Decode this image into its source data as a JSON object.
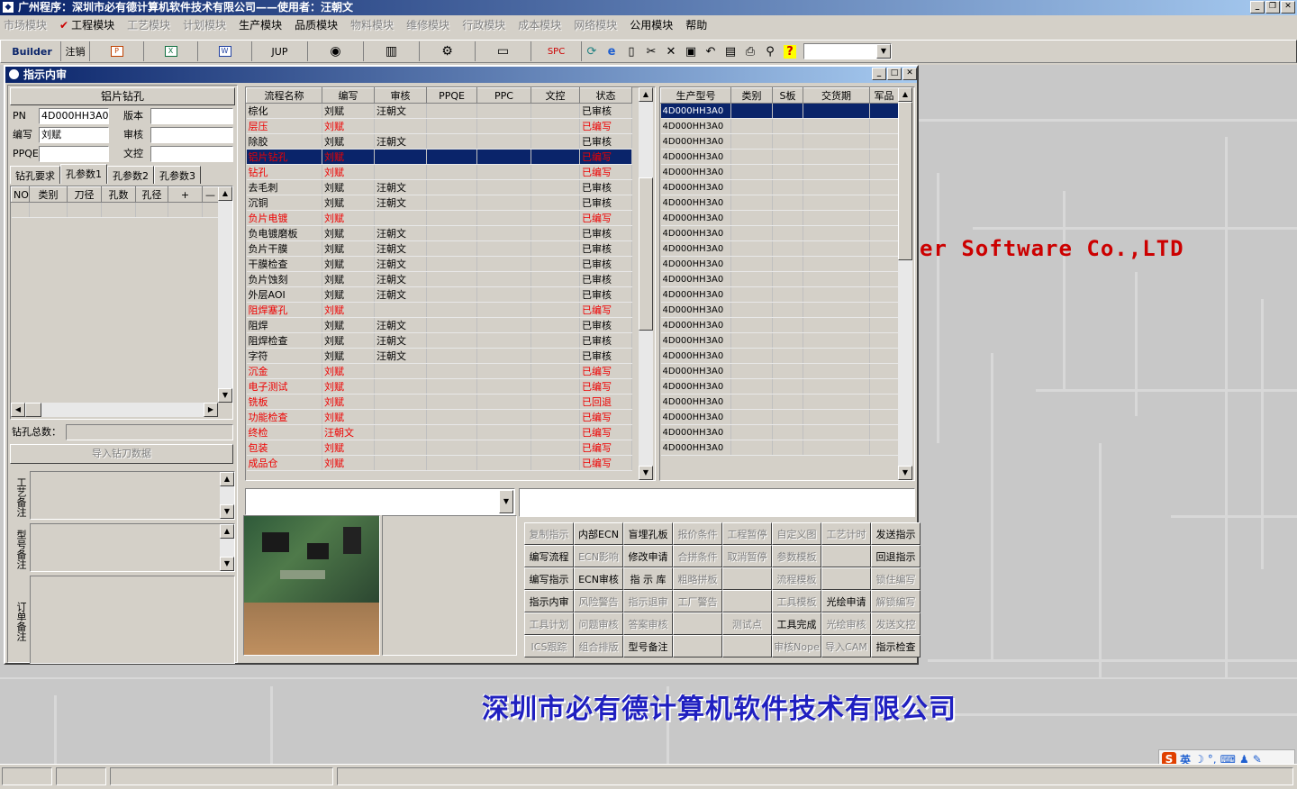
{
  "app": {
    "title": "广州程序：深圳市必有德计算机软件技术有限公司——使用者：汪朝文",
    "icon": "app-icon"
  },
  "menu": [
    {
      "label": "市场模块",
      "enabled": false
    },
    {
      "label": "工程模块",
      "enabled": true,
      "checked": true
    },
    {
      "label": "工艺模块",
      "enabled": false
    },
    {
      "label": "计划模块",
      "enabled": false
    },
    {
      "label": "生产模块",
      "enabled": true
    },
    {
      "label": "品质模块",
      "enabled": true
    },
    {
      "label": "物料模块",
      "enabled": false
    },
    {
      "label": "维修模块",
      "enabled": false
    },
    {
      "label": "行政模块",
      "enabled": false
    },
    {
      "label": "成本模块",
      "enabled": false
    },
    {
      "label": "网络模块",
      "enabled": false
    },
    {
      "label": "公用模块",
      "enabled": true
    },
    {
      "label": "帮助",
      "enabled": true
    }
  ],
  "toolbar": {
    "builder": "Builder",
    "logout": "注销",
    "jup": "JUP",
    "spc": "SPC",
    "icons": [
      "powerpoint-icon",
      "excel-icon",
      "word-icon",
      "jup-icon",
      "eye-icon",
      "database-icon",
      "network-icon",
      "computer-icon",
      "spc-icon",
      "refresh-icon",
      "ie-icon",
      "new-doc-icon",
      "cut-icon",
      "delete-icon",
      "save-icon",
      "undo-icon",
      "preview-icon",
      "print-icon",
      "find-icon",
      "help-icon"
    ]
  },
  "child": {
    "title": "指示内审"
  },
  "left": {
    "header": "铝片钻孔",
    "pn_label": "PN",
    "pn_value": "4D000HH3A0",
    "version_label": "版本",
    "version_value": "",
    "author_label": "编写",
    "author_value": "刘赋",
    "review_label": "审核",
    "review_value": "",
    "ppqe_label": "PPQE",
    "ppqe_value": "",
    "doc_label": "文控",
    "doc_value": "",
    "tabs": [
      "钻孔要求",
      "孔参数1",
      "孔参数2",
      "孔参数3"
    ],
    "active_tab": 1,
    "param_cols": [
      "NO",
      "类别",
      "刀径",
      "孔数",
      "孔径",
      "+",
      "—"
    ],
    "total_label": "钻孔总数：",
    "total_value": "",
    "import_button": "导入钻刀数据",
    "notes": [
      {
        "label": "工艺备注",
        "value": ""
      },
      {
        "label": "型号备注",
        "value": ""
      },
      {
        "label": "订单备注",
        "value": ""
      }
    ]
  },
  "flow": {
    "columns": [
      "流程名称",
      "编写",
      "审核",
      "PPQE",
      "PPC",
      "文控",
      "状态"
    ],
    "rows": [
      {
        "name": "棕化",
        "author": "刘赋",
        "reviewer": "汪朝文",
        "status": "已审核",
        "red": false
      },
      {
        "name": "层压",
        "author": "刘赋",
        "reviewer": "",
        "status": "已编写",
        "red": true
      },
      {
        "name": "除胶",
        "author": "刘赋",
        "reviewer": "汪朝文",
        "status": "已审核",
        "red": false
      },
      {
        "name": "铝片钻孔",
        "author": "刘赋",
        "reviewer": "",
        "status": "已编写",
        "red": true,
        "selected": true
      },
      {
        "name": "钻孔",
        "author": "刘赋",
        "reviewer": "",
        "status": "已编写",
        "red": true
      },
      {
        "name": "去毛刺",
        "author": "刘赋",
        "reviewer": "汪朝文",
        "status": "已审核",
        "red": false
      },
      {
        "name": "沉铜",
        "author": "刘赋",
        "reviewer": "汪朝文",
        "status": "已审核",
        "red": false
      },
      {
        "name": "负片电镀",
        "author": "刘赋",
        "reviewer": "",
        "status": "已编写",
        "red": true
      },
      {
        "name": "负电镀磨板",
        "author": "刘赋",
        "reviewer": "汪朝文",
        "status": "已审核",
        "red": false
      },
      {
        "name": "负片干膜",
        "author": "刘赋",
        "reviewer": "汪朝文",
        "status": "已审核",
        "red": false
      },
      {
        "name": "干膜检查",
        "author": "刘赋",
        "reviewer": "汪朝文",
        "status": "已审核",
        "red": false
      },
      {
        "name": "负片蚀刻",
        "author": "刘赋",
        "reviewer": "汪朝文",
        "status": "已审核",
        "red": false
      },
      {
        "name": "外层AOI",
        "author": "刘赋",
        "reviewer": "汪朝文",
        "status": "已审核",
        "red": false
      },
      {
        "name": "阻焊塞孔",
        "author": "刘赋",
        "reviewer": "",
        "status": "已编写",
        "red": true
      },
      {
        "name": "阻焊",
        "author": "刘赋",
        "reviewer": "汪朝文",
        "status": "已审核",
        "red": false
      },
      {
        "name": "阻焊检查",
        "author": "刘赋",
        "reviewer": "汪朝文",
        "status": "已审核",
        "red": false
      },
      {
        "name": "字符",
        "author": "刘赋",
        "reviewer": "汪朝文",
        "status": "已审核",
        "red": false
      },
      {
        "name": "沉金",
        "author": "刘赋",
        "reviewer": "",
        "status": "已编写",
        "red": true
      },
      {
        "name": "电子测试",
        "author": "刘赋",
        "reviewer": "",
        "status": "已编写",
        "red": true
      },
      {
        "name": "铣板",
        "author": "刘赋",
        "reviewer": "",
        "status": "已回退",
        "red": true
      },
      {
        "name": "功能检查",
        "author": "刘赋",
        "reviewer": "",
        "status": "已编写",
        "red": true
      },
      {
        "name": "终检",
        "author": "汪朝文",
        "reviewer": "",
        "status": "已编写",
        "red": true
      },
      {
        "name": "包装",
        "author": "刘赋",
        "reviewer": "",
        "status": "已编写",
        "red": true
      },
      {
        "name": "成品仓",
        "author": "刘赋",
        "reviewer": "",
        "status": "已编写",
        "red": true
      }
    ]
  },
  "models": {
    "columns": [
      "生产型号",
      "类别",
      "S板",
      "交货期",
      "军品"
    ],
    "rows": [
      "4D000HH3A0",
      "4D000HH3A0",
      "4D000HH3A0",
      "4D000HH3A0",
      "4D000HH3A0",
      "4D000HH3A0",
      "4D000HH3A0",
      "4D000HH3A0",
      "4D000HH3A0",
      "4D000HH3A0",
      "4D000HH3A0",
      "4D000HH3A0",
      "4D000HH3A0",
      "4D000HH3A0",
      "4D000HH3A0",
      "4D000HH3A0",
      "4D000HH3A0",
      "4D000HH3A0",
      "4D000HH3A0",
      "4D000HH3A0",
      "4D000HH3A0",
      "4D000HH3A0",
      "4D000HH3A0"
    ]
  },
  "combo_value": "",
  "memo_value": "",
  "actions": [
    {
      "label": "复制指示",
      "enabled": false
    },
    {
      "label": "内部ECN",
      "enabled": true
    },
    {
      "label": "盲埋孔板",
      "enabled": true
    },
    {
      "label": "报价条件",
      "enabled": false
    },
    {
      "label": "工程暂停",
      "enabled": false
    },
    {
      "label": "自定义图",
      "enabled": false
    },
    {
      "label": "工艺计时",
      "enabled": false
    },
    {
      "label": "发送指示",
      "enabled": true
    },
    {
      "label": "编写流程",
      "enabled": true
    },
    {
      "label": "ECN影响",
      "enabled": false
    },
    {
      "label": "修改申请",
      "enabled": true
    },
    {
      "label": "合拼条件",
      "enabled": false
    },
    {
      "label": "取消暂停",
      "enabled": false
    },
    {
      "label": "参数模板",
      "enabled": false
    },
    {
      "label": "",
      "enabled": false
    },
    {
      "label": "回退指示",
      "enabled": true
    },
    {
      "label": "编写指示",
      "enabled": true
    },
    {
      "label": "ECN审核",
      "enabled": true
    },
    {
      "label": "指 示 库",
      "enabled": true
    },
    {
      "label": "粗略拼板",
      "enabled": false
    },
    {
      "label": "",
      "enabled": false
    },
    {
      "label": "流程模板",
      "enabled": false
    },
    {
      "label": "",
      "enabled": false
    },
    {
      "label": "锁住编写",
      "enabled": false
    },
    {
      "label": "指示内审",
      "enabled": true
    },
    {
      "label": "风险警告",
      "enabled": false
    },
    {
      "label": "指示退审",
      "enabled": false
    },
    {
      "label": "工厂警告",
      "enabled": false
    },
    {
      "label": "",
      "enabled": false
    },
    {
      "label": "工具模板",
      "enabled": false
    },
    {
      "label": "光绘申请",
      "enabled": true
    },
    {
      "label": "解锁编写",
      "enabled": false
    },
    {
      "label": "工具计划",
      "enabled": false
    },
    {
      "label": "问题审核",
      "enabled": false
    },
    {
      "label": "答案审核",
      "enabled": false
    },
    {
      "label": "",
      "enabled": false
    },
    {
      "label": "测试点",
      "enabled": false
    },
    {
      "label": "工具完成",
      "enabled": true
    },
    {
      "label": "光绘审核",
      "enabled": false
    },
    {
      "label": "发送文控",
      "enabled": false
    },
    {
      "label": "ICS跟踪",
      "enabled": false
    },
    {
      "label": "组合排版",
      "enabled": false
    },
    {
      "label": "型号备注",
      "enabled": true
    },
    {
      "label": "",
      "enabled": false
    },
    {
      "label": "",
      "enabled": false
    },
    {
      "label": "审核Nope",
      "enabled": false
    },
    {
      "label": "导入CAM",
      "enabled": false
    },
    {
      "label": "指示检查",
      "enabled": true
    }
  ],
  "background": {
    "brand_text": "er Software Co.,LTD",
    "company_text": "深圳市必有德计算机软件技术有限公司"
  },
  "ime": {
    "lang": "英",
    "icons": [
      "sogou-icon",
      "moon-icon",
      "punct-icon",
      "keyboard-icon",
      "user-icon",
      "wrench-icon"
    ]
  },
  "colors": {
    "title_start": "#0a246a",
    "title_end": "#a6caf0",
    "error_red": "#e00000",
    "company_blue": "#2020c0"
  }
}
